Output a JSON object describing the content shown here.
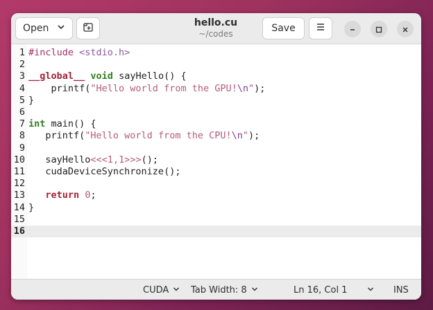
{
  "header": {
    "open_label": "Open",
    "save_label": "Save",
    "title": "hello.cu",
    "subtitle": "~/codes"
  },
  "editor": {
    "current_line": 16,
    "lines": [
      {
        "n": "1",
        "tokens": [
          {
            "t": "#include ",
            "c": "c-pre"
          },
          {
            "t": "<stdio.h>",
            "c": "c-inc"
          }
        ]
      },
      {
        "n": "2",
        "tokens": []
      },
      {
        "n": "3",
        "tokens": [
          {
            "t": "__global__",
            "c": "c-ctl"
          },
          {
            "t": " ",
            "c": ""
          },
          {
            "t": "void",
            "c": "c-kw"
          },
          {
            "t": " sayHello() {",
            "c": ""
          }
        ]
      },
      {
        "n": "4",
        "tokens": [
          {
            "t": "    printf(",
            "c": ""
          },
          {
            "t": "\"Hello world from the GPU!",
            "c": "c-str"
          },
          {
            "t": "\\n",
            "c": "c-esc"
          },
          {
            "t": "\"",
            "c": "c-str"
          },
          {
            "t": ");",
            "c": ""
          }
        ]
      },
      {
        "n": "5",
        "tokens": [
          {
            "t": "}",
            "c": ""
          }
        ]
      },
      {
        "n": "6",
        "tokens": []
      },
      {
        "n": "7",
        "tokens": [
          {
            "t": "int",
            "c": "c-kw"
          },
          {
            "t": " main() {",
            "c": ""
          }
        ]
      },
      {
        "n": "8",
        "tokens": [
          {
            "t": "   printf(",
            "c": ""
          },
          {
            "t": "\"Hello world from the CPU!",
            "c": "c-str"
          },
          {
            "t": "\\n",
            "c": "c-esc"
          },
          {
            "t": "\"",
            "c": "c-str"
          },
          {
            "t": ");",
            "c": ""
          }
        ]
      },
      {
        "n": "9",
        "tokens": []
      },
      {
        "n": "10",
        "tokens": [
          {
            "t": "   sayHello",
            "c": ""
          },
          {
            "t": "<<<",
            "c": "c-sym"
          },
          {
            "t": "1",
            "c": "c-num"
          },
          {
            "t": ",",
            "c": "c-sym"
          },
          {
            "t": "1",
            "c": "c-num"
          },
          {
            "t": ">>>",
            "c": "c-sym"
          },
          {
            "t": "();",
            "c": ""
          }
        ]
      },
      {
        "n": "11",
        "tokens": [
          {
            "t": "   cudaDeviceSynchronize();",
            "c": ""
          }
        ]
      },
      {
        "n": "12",
        "tokens": []
      },
      {
        "n": "13",
        "tokens": [
          {
            "t": "   ",
            "c": ""
          },
          {
            "t": "return",
            "c": "c-ctl"
          },
          {
            "t": " ",
            "c": ""
          },
          {
            "t": "0",
            "c": "c-num"
          },
          {
            "t": ";",
            "c": ""
          }
        ]
      },
      {
        "n": "14",
        "tokens": [
          {
            "t": "}",
            "c": ""
          }
        ]
      },
      {
        "n": "15",
        "tokens": []
      },
      {
        "n": "16",
        "tokens": []
      }
    ]
  },
  "statusbar": {
    "language": "CUDA",
    "tab_width": "Tab Width: 8",
    "position": "Ln 16, Col 1",
    "mode": "INS"
  },
  "icons": {
    "open": "chevron-down-icon",
    "new_tab": "new-tab-icon",
    "menu": "hamburger-menu-icon",
    "minimize": "minimize-icon",
    "maximize": "maximize-icon",
    "close": "close-icon"
  }
}
